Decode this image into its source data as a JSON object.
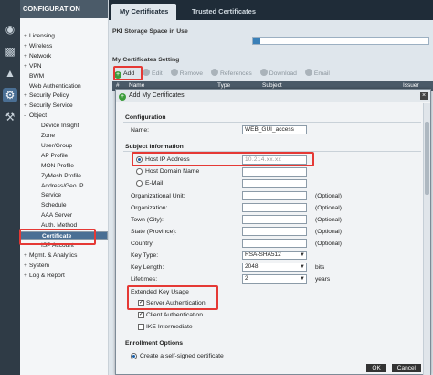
{
  "nav": {
    "header": "CONFIGURATION",
    "items": [
      {
        "label": "Licensing",
        "toggle": "+"
      },
      {
        "label": "Wireless",
        "toggle": "+"
      },
      {
        "label": "Network",
        "toggle": "+"
      },
      {
        "label": "VPN",
        "toggle": "+"
      },
      {
        "label": "BWM",
        "toggle": ""
      },
      {
        "label": "Web Authentication",
        "toggle": ""
      },
      {
        "label": "Security Policy",
        "toggle": "+"
      },
      {
        "label": "Security Service",
        "toggle": "+"
      },
      {
        "label": "Object",
        "toggle": "-"
      },
      {
        "label": "Device Insight",
        "toggle": ""
      },
      {
        "label": "Zone",
        "toggle": ""
      },
      {
        "label": "User/Group",
        "toggle": ""
      },
      {
        "label": "AP Profile",
        "toggle": ""
      },
      {
        "label": "MON Profile",
        "toggle": ""
      },
      {
        "label": "ZyMesh Profile",
        "toggle": ""
      },
      {
        "label": "Address/Geo IP",
        "toggle": ""
      },
      {
        "label": "Service",
        "toggle": ""
      },
      {
        "label": "Schedule",
        "toggle": ""
      },
      {
        "label": "AAA Server",
        "toggle": ""
      },
      {
        "label": "Auth. Method",
        "toggle": ""
      },
      {
        "label": "Certificate",
        "toggle": ""
      },
      {
        "label": "ISP Account",
        "toggle": ""
      },
      {
        "label": "Mgmt. & Analytics",
        "toggle": "+"
      },
      {
        "label": "System",
        "toggle": "+"
      },
      {
        "label": "Log & Report",
        "toggle": "+"
      }
    ]
  },
  "tabs": [
    "My Certificates",
    "Trusted Certificates"
  ],
  "pki": {
    "label": "PKI Storage Space in Use",
    "usage_fraction": 0.04
  },
  "setting_title": "My Certificates Setting",
  "toolbar": [
    "Add",
    "Edit",
    "Remove",
    "References",
    "Download",
    "Email"
  ],
  "table_header": {
    "col_hash": "#",
    "col_name": "Name",
    "col_type": "Type",
    "col_subject": "Subject",
    "col_issuer": "Issuer"
  },
  "dialog": {
    "title": "Add My Certificates",
    "config_header": "Configuration",
    "name_label": "Name:",
    "name_value": "WEB_GUI_access",
    "subject_header": "Subject Information",
    "host_ip_label": "Host IP Address",
    "host_ip_value": "10.214.xx.xx",
    "host_domain_label": "Host Domain Name",
    "email_label": "E-Mail",
    "org_unit_label": "Organizational Unit:",
    "org_label": "Organization:",
    "town_label": "Town (City):",
    "state_label": "State (Province):",
    "country_label": "Country:",
    "optional_text": "(Optional)",
    "key_type_label": "Key Type:",
    "key_type_value": "RSA-SHA512",
    "key_length_label": "Key Length:",
    "key_length_value": "2048",
    "key_length_unit": "bits",
    "lifetime_label": "Lifetimes:",
    "lifetime_value": "2",
    "lifetime_unit": "years",
    "eku_header": "Extended Key Usage",
    "eku_server": "Server Authentication",
    "eku_client": "Client Authentication",
    "eku_ike": "IKE Intermediate",
    "enroll_header": "Enrollment Options",
    "self_signed": "Create a self-signed certificate",
    "ok": "OK",
    "cancel": "Cancel"
  },
  "colors": {
    "highlight": "#e53935",
    "selected_nav": "#4a6f94",
    "header_dark": "#1f2c38"
  }
}
